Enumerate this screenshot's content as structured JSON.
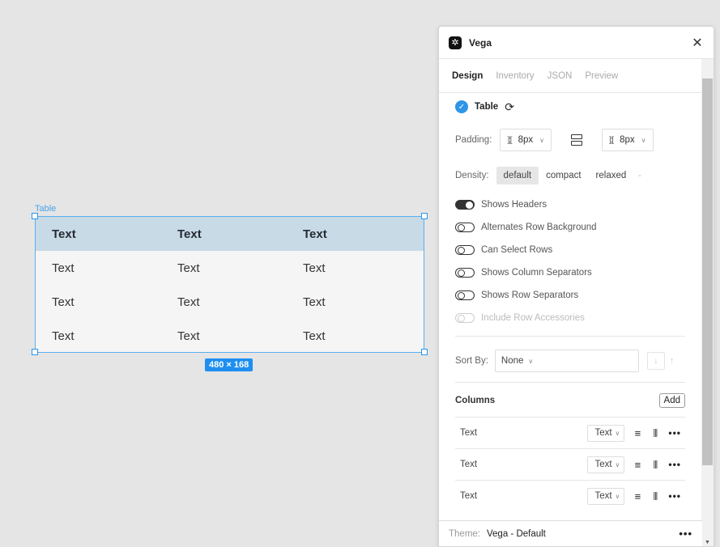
{
  "canvas": {
    "frame_label": "Table",
    "size_badge": "480 × 168",
    "table": {
      "headers": [
        "Text",
        "Text",
        "Text"
      ],
      "rows": [
        [
          "Text",
          "Text",
          "Text"
        ],
        [
          "Text",
          "Text",
          "Text"
        ],
        [
          "Text",
          "Text",
          "Text"
        ]
      ]
    }
  },
  "panel": {
    "title": "Vega",
    "tabs": [
      "Design",
      "Inventory",
      "JSON",
      "Preview"
    ],
    "active_tab": "Design",
    "component": {
      "name": "Table"
    },
    "padding": {
      "label": "Padding:",
      "horizontal": "8px",
      "vertical": "8px"
    },
    "density": {
      "label": "Density:",
      "options": [
        "default",
        "compact",
        "relaxed"
      ],
      "selected": "default",
      "extra": "-"
    },
    "toggles": [
      {
        "label": "Shows Headers",
        "on": true,
        "disabled": false
      },
      {
        "label": "Alternates Row Background",
        "on": false,
        "disabled": false
      },
      {
        "label": "Can Select Rows",
        "on": false,
        "disabled": false
      },
      {
        "label": "Shows Column Separators",
        "on": false,
        "disabled": false
      },
      {
        "label": "Shows Row Separators",
        "on": false,
        "disabled": false
      },
      {
        "label": "Include Row Accessories",
        "on": false,
        "disabled": true
      }
    ],
    "sort": {
      "label": "Sort By:",
      "value": "None"
    },
    "columns": {
      "title": "Columns",
      "add_label": "Add",
      "items": [
        {
          "name": "Text",
          "type": "Text"
        },
        {
          "name": "Text",
          "type": "Text"
        },
        {
          "name": "Text",
          "type": "Text"
        }
      ]
    },
    "footer": {
      "theme_label": "Theme:",
      "theme_value": "Vega - Default"
    }
  },
  "colors": {
    "accent": "#2f95e6",
    "header_row": "#c8dae6"
  },
  "icons": [
    "vega-logo-icon",
    "close-icon",
    "check-badge-icon",
    "refresh-icon",
    "padding-horizontal-icon",
    "padding-vertical-icon",
    "split-layout-icon",
    "sort-desc-icon",
    "sort-asc-icon",
    "align-left-icon",
    "align-columns-icon",
    "more-icon"
  ]
}
